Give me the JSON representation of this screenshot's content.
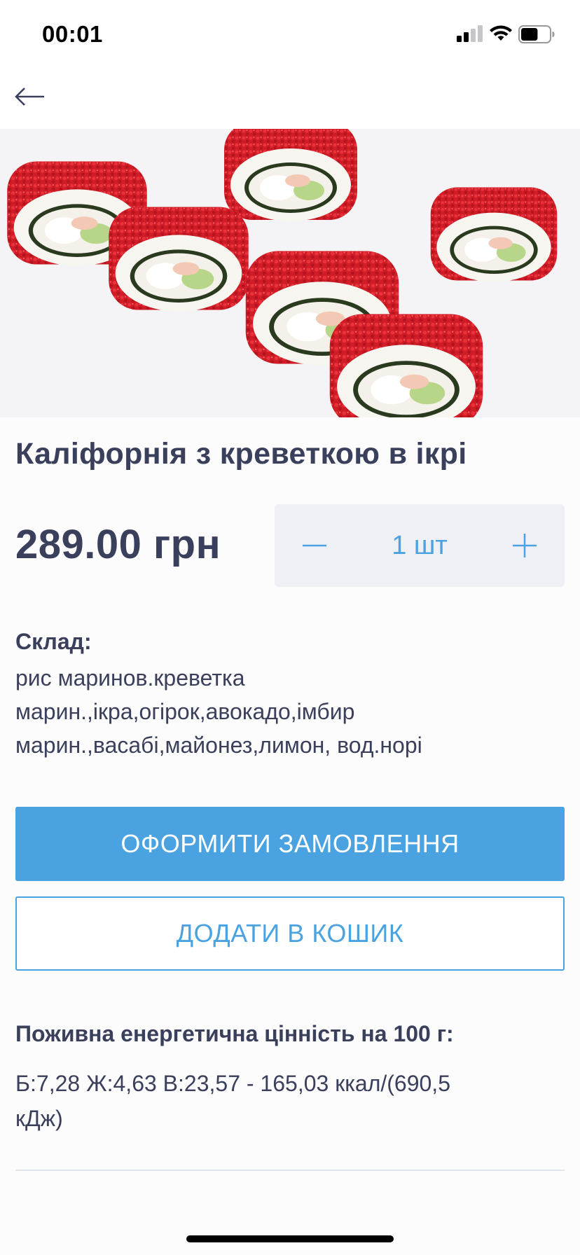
{
  "status_bar": {
    "time": "00:01",
    "battery_level": 0.6
  },
  "nav": {
    "back_icon": "arrow-left-icon"
  },
  "product": {
    "image_subject": "sushi rolls with red caviar",
    "title": "Каліфорнія з креветкою в ікрі",
    "price": "289.00 грн",
    "quantity": "1 шт",
    "composition_label": "Склад:",
    "composition_lines": [
      "рис маринов.креветка",
      "марин.,ікра,огірок,авокадо,імбир",
      "марин.,васабі,майонез,лимон, вод.норі"
    ]
  },
  "actions": {
    "order_label": "ОФОРМИТИ ЗАМОВЛЕННЯ",
    "cart_label": "ДОДАТИ В КОШИК"
  },
  "nutrition": {
    "label": "Поживна енергетична цінність на 100 г:",
    "lines": [
      "Б:7,28 Ж:4,63 В:23,57 - 165,03 ккал/(690,5",
      "кДж)"
    ]
  },
  "colors": {
    "accent": "#4aa3e0",
    "text": "#3a3f5c",
    "qty_bg": "#eef0f5",
    "caviar": "#d9202a"
  }
}
